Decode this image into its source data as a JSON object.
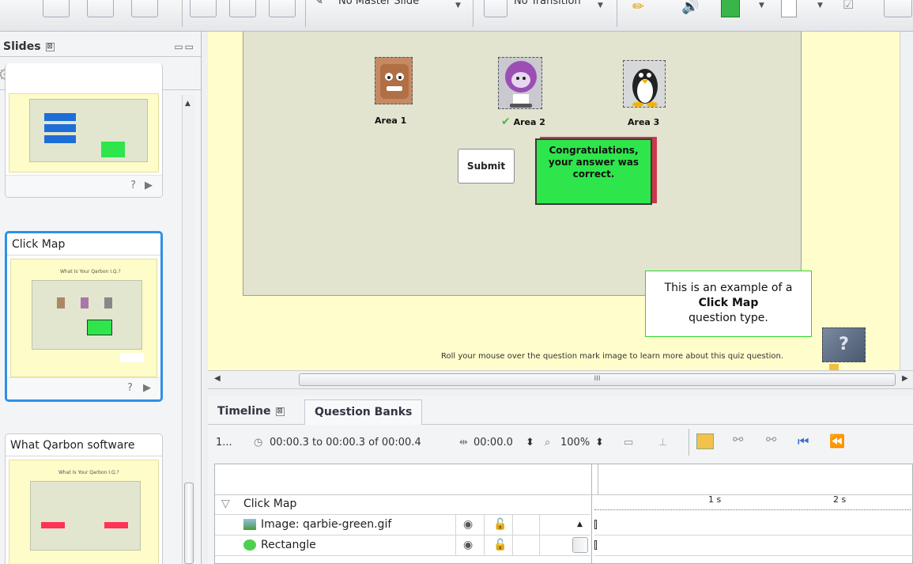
{
  "toolbar": {
    "master_slide": "No Master Slide",
    "transition": "No Transition"
  },
  "slides_panel": {
    "title": "Slides",
    "close_glyph": "⊠",
    "window_controls": "▭▭",
    "slides": [
      {
        "label": "",
        "footer_icons": [
          "?",
          "▶"
        ]
      },
      {
        "label": "Click Map",
        "thumb_title": "What Is Your Qarbon I.Q.?",
        "footer_icons": [
          "?",
          "▶"
        ]
      },
      {
        "label": "What Qarbon software",
        "thumb_title": "What Is Your Qarbon I.Q.?"
      }
    ]
  },
  "stage": {
    "areas": [
      {
        "label": "Area 1",
        "icon": "face-icon"
      },
      {
        "label": "Area 2",
        "icon": "purple-character-icon"
      },
      {
        "label": "Area 3",
        "icon": "penguin-icon"
      }
    ],
    "submit_label": "Submit",
    "feedback": "Congratulations, your answer was correct.",
    "callout_line1": "This is an example of a",
    "callout_bold": "Click Map",
    "callout_line3": "question type.",
    "hint": "Roll your mouse over the question mark image to learn more about this quiz question.",
    "question_mark": "?",
    "scroll_thumb_text": "III"
  },
  "timeline": {
    "tab_timeline": "Timeline",
    "tab_question_banks": "Question Banks",
    "close_glyph": "⊠",
    "slide_num": "1...",
    "time_range": "00:00.3 to 00:00.3 of 00:00.4",
    "duration": "00:00.0",
    "zoom": "100%",
    "ruler_1s": "1 s",
    "ruler_2s": "2 s",
    "rows": [
      {
        "name": "Click Map",
        "type": "group"
      },
      {
        "name": "Image: qarbie-green.gif",
        "type": "image"
      },
      {
        "name": "Rectangle",
        "type": "shape"
      }
    ]
  },
  "colors": {
    "stage_bg": "#fffdcb",
    "feedback_green": "#2ee64b",
    "feedback_shadow": "#c9394b",
    "callout_border": "#2bd82b",
    "selection_blue": "#2f8fe6"
  }
}
